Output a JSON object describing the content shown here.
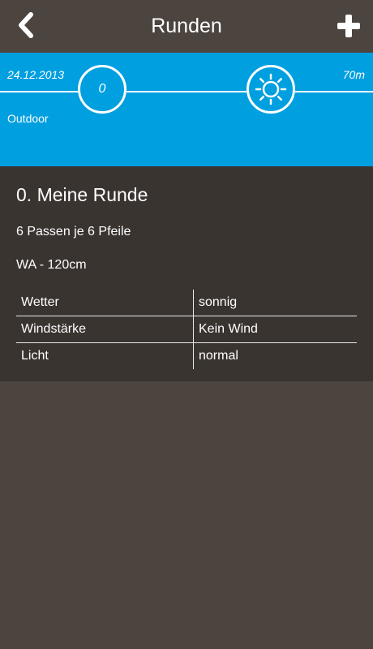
{
  "header": {
    "title": "Runden",
    "back_icon": "chevron-left-icon",
    "add_icon": "plus-icon"
  },
  "banner": {
    "date": "24.12.2013",
    "location": "Outdoor",
    "count": "0",
    "distance": "70m",
    "weather_icon": "sun-icon",
    "color": "#009fe0"
  },
  "round": {
    "title": "0. Meine Runde",
    "arrows": "6 Passen je 6 Pfeile",
    "target": "WA - 120cm",
    "properties": [
      {
        "label": "Wetter",
        "value": "sonnig"
      },
      {
        "label": "Windstärke",
        "value": "Kein Wind"
      },
      {
        "label": "Licht",
        "value": "normal"
      }
    ]
  },
  "colors": {
    "background": "#4b443f",
    "card": "#3a3431"
  }
}
